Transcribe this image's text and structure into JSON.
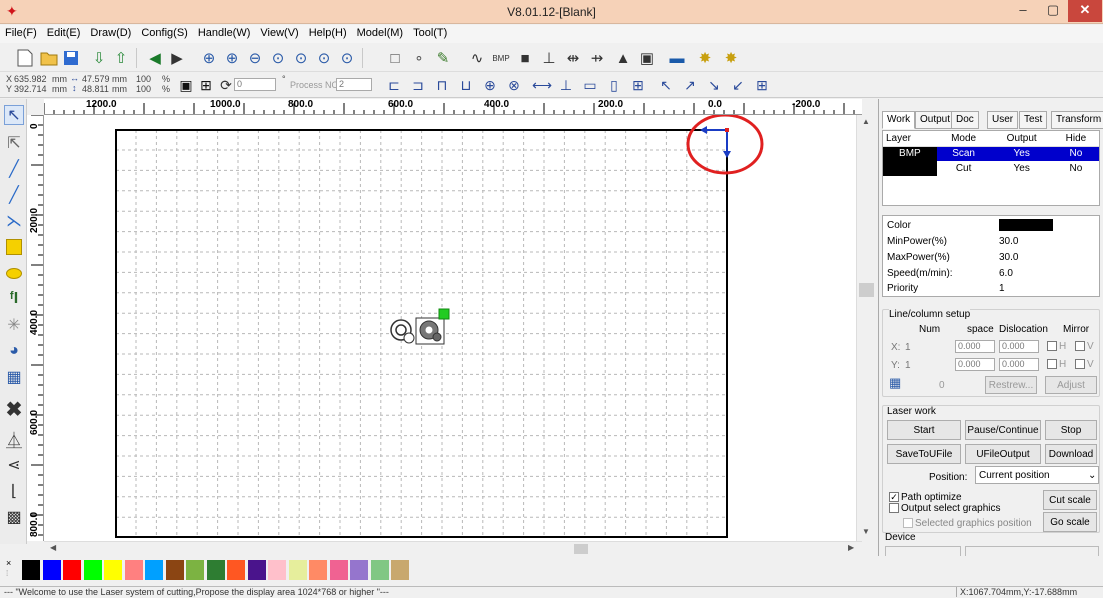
{
  "window": {
    "title": "V8.01.12-[Blank]",
    "minimize": "–",
    "maximize": "▢",
    "close": "✕"
  },
  "menu": [
    "File(F)",
    "Edit(E)",
    "Draw(D)",
    "Config(S)",
    "Handle(W)",
    "View(V)",
    "Help(H)",
    "Model(M)",
    "Tool(T)"
  ],
  "toolbar2": {
    "x_label": "X",
    "x_value": "635.982",
    "x_unit": "mm",
    "y_label": "Y",
    "y_value": "392.714",
    "y_unit": "mm",
    "w_value": "47.579",
    "w_unit": "mm",
    "h_value": "48.811",
    "h_unit": "mm",
    "w_pct": "100",
    "h_pct": "100",
    "pct_unit": "%",
    "angle": "0",
    "angle_unit": "°",
    "process_label": "Process NO:",
    "process_no": "2"
  },
  "ruler": {
    "top": [
      "1200.0",
      "1000.0",
      "800.0",
      "600.0",
      "400.0",
      "200.0",
      "0.0",
      "-200.0"
    ],
    "left": [
      "0",
      "200.0",
      "400.0",
      "600.0",
      "800.0"
    ]
  },
  "panel": {
    "tabs": [
      "Work",
      "Output",
      "Doc",
      "User",
      "Test",
      "Transform"
    ],
    "layer_headers": [
      "Layer",
      "Mode",
      "Output",
      "Hide"
    ],
    "layers": [
      {
        "name": "BMP",
        "mode": "Scan",
        "output": "Yes",
        "hide": "No",
        "color": "#000000",
        "selected": true
      },
      {
        "name": "",
        "mode": "Cut",
        "output": "Yes",
        "hide": "No",
        "color": "#000000",
        "selected": false
      }
    ],
    "props": [
      {
        "label": "Color",
        "value": ""
      },
      {
        "label": "MinPower(%)",
        "value": "30.0"
      },
      {
        "label": "MaxPower(%)",
        "value": "30.0"
      },
      {
        "label": "Speed(m/min):",
        "value": "6.0"
      },
      {
        "label": "Priority",
        "value": "1"
      }
    ],
    "linecol": {
      "title": "Line/column setup",
      "headers": [
        "Num",
        "space",
        "Dislocation",
        "Mirror"
      ],
      "x_label": "X:",
      "x_num": "1",
      "x_space": "0.000",
      "x_disl": "0.000",
      "y_label": "Y:",
      "y_num": "1",
      "y_space": "0.000",
      "y_disl": "0.000",
      "mirror_h": "H",
      "mirror_v": "V",
      "zero": "0",
      "restrew": "Restrew...",
      "adjust": "Adjust"
    },
    "laser": {
      "title": "Laser work",
      "start": "Start",
      "pause": "Pause/Continue",
      "stop": "Stop",
      "save": "SaveToUFile",
      "ufile": "UFileOutput",
      "download": "Download",
      "position_label": "Position:",
      "position_value": "Current position",
      "path_optimize": "Path optimize",
      "output_select": "Output select graphics",
      "selected_pos": "Selected graphics position",
      "cut_scale": "Cut scale",
      "go_scale": "Go scale"
    },
    "device_title": "Device"
  },
  "palette": [
    "#000000",
    "#0000ff",
    "#ff0000",
    "#00ff00",
    "#ffff00",
    "#ff8080",
    "#00a0ff",
    "#8b4513",
    "#7cb342",
    "#2e7d32",
    "#ff5722",
    "#4a148c",
    "#ffc0cb",
    "#e6ee9c",
    "#ff8a65",
    "#f06292",
    "#9575cd",
    "#81c784",
    "#c8a86e"
  ],
  "status": {
    "message": "--- \"Welcome to use the Laser system of cutting,Propose the display area 1024*768 or higher \"---",
    "coords": "X:1067.704mm,Y:-17.688mm"
  },
  "colors": {
    "selection": "#0000cc",
    "annotation": "#e02020",
    "origin_arrow": "#1a3cc4",
    "handle": "#22cc22"
  }
}
